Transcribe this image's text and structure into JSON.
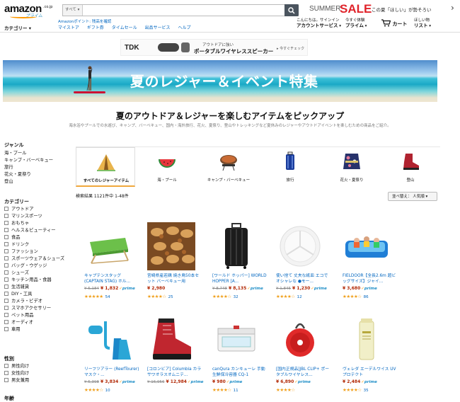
{
  "header": {
    "logo_text": "amazon",
    "logo_domain": ".co.jp",
    "logo_prime": "プライム",
    "search_category": "すべて",
    "promo_summer": "SUMMER",
    "promo_sale": "SALE",
    "promo_text": "この夏「ほしい」が勢そろい",
    "nav_category": "カテゴリー",
    "amazon_point": "Amazonポイント: 残高を確認",
    "nav_links": [
      "マイストア",
      "ギフト券",
      "タイムセール",
      "出品サービス",
      "ヘルプ"
    ],
    "account_greeting": "こんにちは。サインイン",
    "account_service": "アカウントサービス",
    "prime_line1": "今すぐ体験",
    "prime_line2": "プライム",
    "cart_label": "カート",
    "wishlist_line1": "ほしい物",
    "wishlist_line2": "リスト"
  },
  "ad": {
    "brand": "TDK",
    "line1": "アウトドアに強い",
    "line2": "ポータブルワイヤレススピーカー",
    "check": "今すぐチェック"
  },
  "banner": {
    "title": "夏のレジャー＆イベント特集"
  },
  "headline": {
    "title": "夏のアウトドア＆レジャーを楽しむアイテムをピックアップ",
    "subtitle": "海水浴やプールでの水遊び、キャンプ、バーベキュー、国内・海外旅行、花火、夏祭り、登山やトレッキングなど夏休みのレジャーやアウトドアイベントを楽しむための商品をご紹介。"
  },
  "sidebar": {
    "genre_title": "ジャンル",
    "genre_items": [
      "海・プール",
      "キャンプ・バーベキュー",
      "旅行",
      "花火・夏祭り",
      "登山"
    ],
    "category_title": "カテゴリー",
    "category_items": [
      "アウトドア",
      "マリンスポーツ",
      "おもちゃ",
      "ヘルス＆ビューティー",
      "食品",
      "ドリンク",
      "ファッション",
      "スポーツウェア＆シューズ",
      "バッグ・ウゲッジ",
      "シューズ",
      "キッチン用品・食器",
      "生活雑貨",
      "DIY・工具",
      "カメラ・ビデオ",
      "スマホアクセサリー",
      "ペット用品",
      "オーディオ",
      "車用"
    ],
    "gender_title": "性別",
    "gender_items": [
      "男性向け",
      "女性向け",
      "男女兼用"
    ],
    "age_title": "年齢"
  },
  "categories": [
    {
      "label": "すべてのレジャーアイテム",
      "icon": "tent-icon"
    },
    {
      "label": "海・プール",
      "icon": "watermelon-icon"
    },
    {
      "label": "キャンプ・バーベキュー",
      "icon": "bbq-icon"
    },
    {
      "label": "旅行",
      "icon": "suitcase-icon"
    },
    {
      "label": "花火・夏祭り",
      "icon": "yukata-icon"
    },
    {
      "label": "登山",
      "icon": "boot-icon"
    }
  ],
  "results": {
    "text": "検索結果 1121件中 1-48件",
    "sort_label": "並べ替え： 人気順"
  },
  "products": [
    {
      "title": "キャプテンスタッグ (CAPTAIN STAG) ホル...",
      "old_price": "¥ 5,184",
      "price": "¥ 1,832",
      "prime": true,
      "stars": "★★★★★",
      "count": "54",
      "icon": "folding-table-icon"
    },
    {
      "title": "宮崎県産若鶏 焼き鳥50本セット バーベキュー用",
      "old_price": "",
      "price": "¥ 2,980",
      "prime": false,
      "stars": "★★★★☆",
      "count": "25",
      "icon": "yakitori-icon"
    },
    {
      "title": "[ワールド ホッパー] WORLD HOPPER [A...",
      "old_price": "¥ 8,748",
      "price": "¥ 8,135",
      "prime": true,
      "stars": "★★★★☆",
      "count": "32",
      "icon": "suitcase-icon"
    },
    {
      "title": "使い捨て 丈夫な紙皿 エコでオシャレな ●モー...",
      "old_price": "¥ 1,845",
      "price": "¥ 1,230",
      "prime": true,
      "stars": "★★★★☆",
      "count": "12",
      "icon": "paper-plate-icon"
    },
    {
      "title": "FIELDOOR【全長2.6m 超ビッグサイズ】ジャイ...",
      "old_price": "",
      "price": "¥ 3,680",
      "prime": true,
      "stars": "★★★★☆",
      "count": "86",
      "icon": "pool-icon"
    },
    {
      "title": "リーフツアラー (ReefTourer) マスク・...",
      "old_price": "¥ 5,398",
      "price": "¥ 3,834",
      "prime": true,
      "stars": "★★★★☆",
      "count": "10",
      "icon": "snorkel-icon"
    },
    {
      "title": "[コロンビア] Columbia カラサワオラスオムニテ...",
      "old_price": "¥ 16,956",
      "price": "¥ 12,984",
      "prime": true,
      "stars": "",
      "count": "",
      "icon": "hiking-boot-icon"
    },
    {
      "title": "canQura カンキューレ 手動 生鮮保冷容器 CQ-1",
      "old_price": "",
      "price": "¥ 980",
      "prime": true,
      "stars": "★★★★☆",
      "count": "11",
      "icon": "cooler-icon"
    },
    {
      "title": "[国内正規品]JBL CLIP+ ポータブルワイヤレス...",
      "old_price": "",
      "price": "¥ 6,890",
      "prime": true,
      "stars": "★★★★☆",
      "count": "",
      "icon": "speaker-icon"
    },
    {
      "title": "ヴェレダ エーデルワイス UVプロテクト",
      "old_price": "",
      "price": "¥ 2,484",
      "prime": true,
      "stars": "★★★★☆",
      "count": "35",
      "icon": "sunscreen-icon"
    }
  ]
}
